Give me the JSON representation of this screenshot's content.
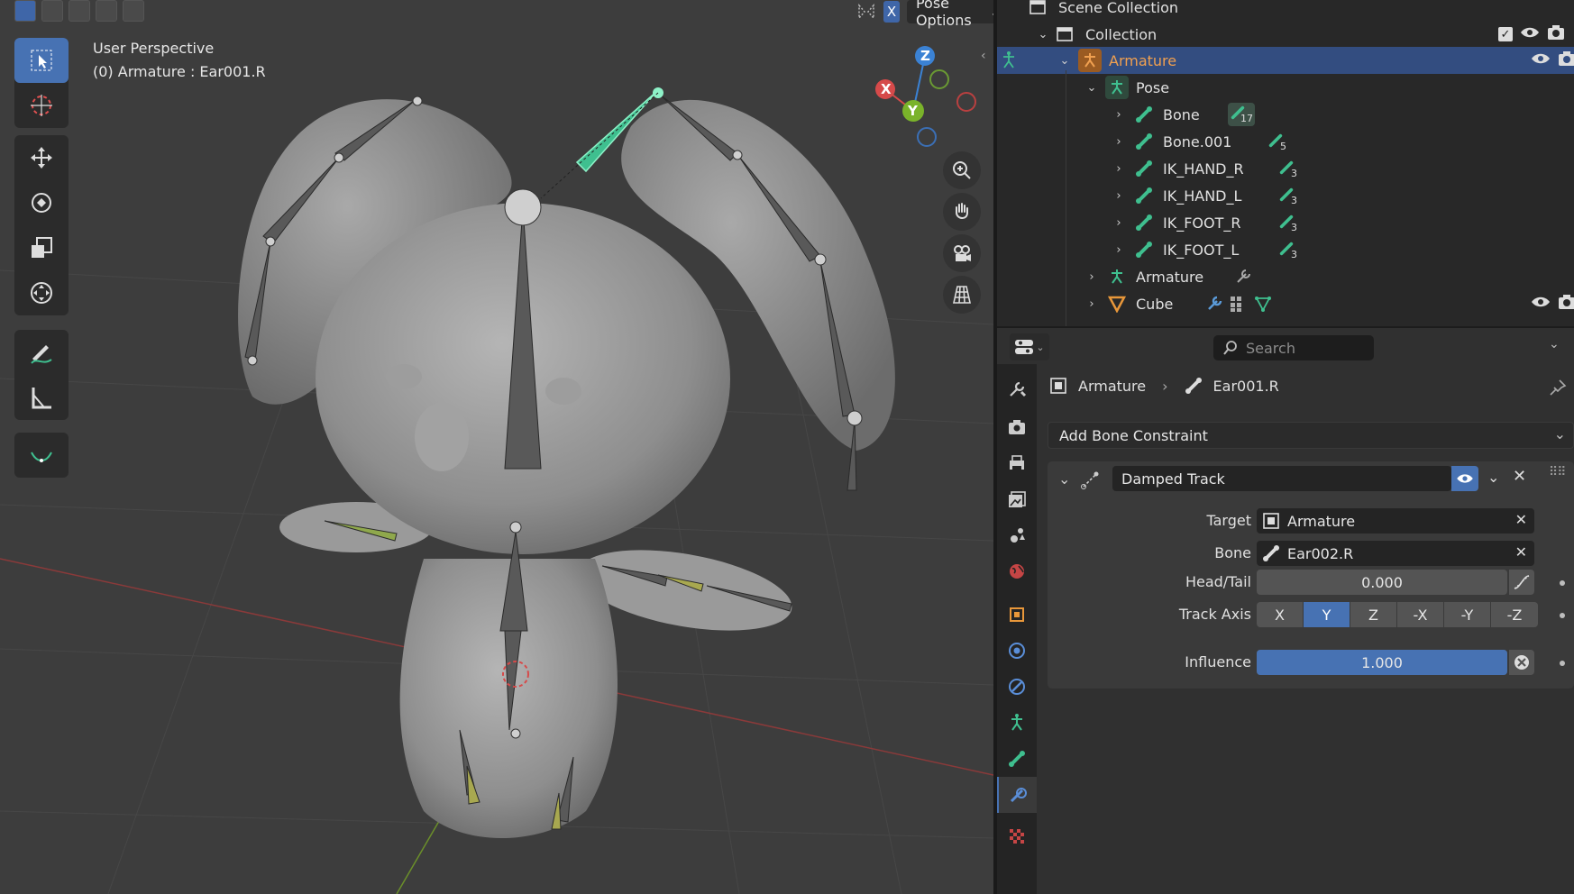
{
  "viewport": {
    "title": "User Perspective",
    "subtitle": "(0) Armature : Ear001.R",
    "pose_options_label": "Pose Options",
    "x_toggle": "X",
    "gizmo": {
      "x": "X",
      "y": "Y",
      "z": "Z"
    }
  },
  "toolbar": {
    "tools": [
      "select-box",
      "cursor",
      "move",
      "rotate",
      "scale",
      "transform",
      "annotate",
      "measure",
      "bone-envelope"
    ],
    "active": "select-box"
  },
  "outliner": {
    "scene_collection": "Scene Collection",
    "collection": "Collection",
    "armature": "Armature",
    "pose": "Pose",
    "bones": [
      {
        "name": "Bone",
        "count": "17"
      },
      {
        "name": "Bone.001",
        "count": "5"
      },
      {
        "name": "IK_HAND_R",
        "count": "3"
      },
      {
        "name": "IK_HAND_L",
        "count": "3"
      },
      {
        "name": "IK_FOOT_R",
        "count": "3"
      },
      {
        "name": "IK_FOOT_L",
        "count": "3"
      }
    ],
    "armature_data": "Armature",
    "cube": "Cube"
  },
  "properties": {
    "search_placeholder": "Search",
    "breadcrumb_object": "Armature",
    "breadcrumb_bone": "Ear001.R",
    "add_constraint": "Add Bone Constraint",
    "constraint": {
      "name": "Damped Track",
      "target_label": "Target",
      "target_value": "Armature",
      "bone_label": "Bone",
      "bone_value": "Ear002.R",
      "headtail_label": "Head/Tail",
      "headtail_value": "0.000",
      "track_axis_label": "Track Axis",
      "track_axis_options": [
        "X",
        "Y",
        "Z",
        "-X",
        "-Y",
        "-Z"
      ],
      "track_axis_selected": "Y",
      "influence_label": "Influence",
      "influence_value": "1.000",
      "influence_fraction": 1.0
    }
  },
  "colors": {
    "accent": "#4772b3",
    "selected_row": "#334d80",
    "bone_active": "#3fbf8f",
    "armature_orange": "#e8973a"
  }
}
